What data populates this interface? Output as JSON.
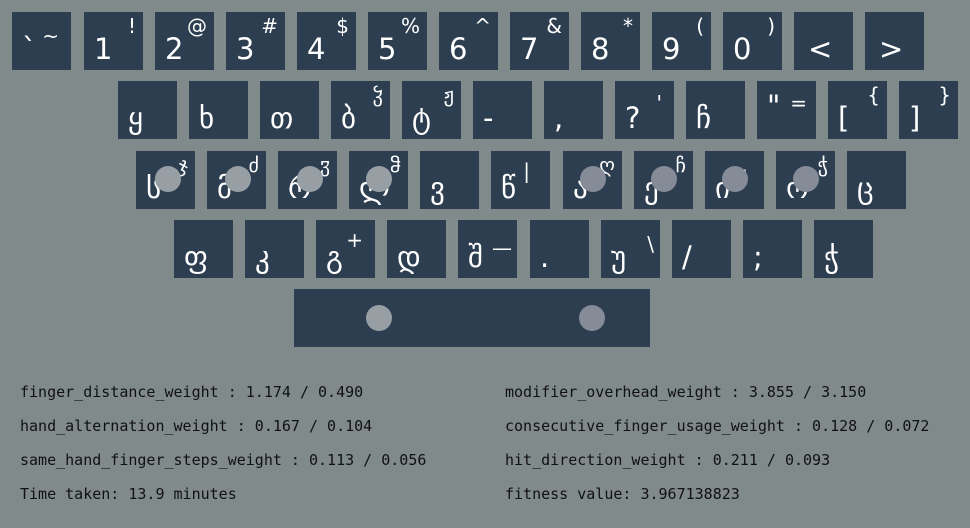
{
  "rows": [
    [
      {
        "main": "`",
        "shift": "~"
      },
      {
        "main": "1",
        "shift": "!"
      },
      {
        "main": "2",
        "shift": "@"
      },
      {
        "main": "3",
        "shift": "#"
      },
      {
        "main": "4",
        "shift": "$"
      },
      {
        "main": "5",
        "shift": "%"
      },
      {
        "main": "6",
        "shift": "^"
      },
      {
        "main": "7",
        "shift": "&"
      },
      {
        "main": "8",
        "shift": "*"
      },
      {
        "main": "9",
        "shift": "("
      },
      {
        "main": "0",
        "shift": ")"
      },
      {
        "main": "<",
        "shift": ""
      },
      {
        "main": ">",
        "shift": ""
      }
    ],
    [
      {
        "main": "ყ",
        "shift": ""
      },
      {
        "main": "ხ",
        "shift": ""
      },
      {
        "main": "თ",
        "shift": ""
      },
      {
        "main": "ბ",
        "shift": "ჴ"
      },
      {
        "main": "ტ",
        "shift": "ჟ"
      },
      {
        "main": "-",
        "shift": ""
      },
      {
        "main": ",",
        "shift": ""
      },
      {
        "main": "?",
        "shift": "'"
      },
      {
        "main": "ჩ",
        "shift": ""
      },
      {
        "main": "\"",
        "shift": "="
      },
      {
        "main": "[",
        "shift": "{"
      },
      {
        "main": "]",
        "shift": "}"
      }
    ],
    [
      {
        "main": "ს",
        "shift": "ჯ"
      },
      {
        "main": "მ",
        "shift": "ძ"
      },
      {
        "main": "რ",
        "shift": "ჳ"
      },
      {
        "main": "ლ",
        "shift": "ჵ"
      },
      {
        "main": "ვ",
        "shift": ""
      },
      {
        "main": "წ",
        "shift": "|"
      },
      {
        "main": "ა",
        "shift": "ღ"
      },
      {
        "main": "ე",
        "shift": "ჩ"
      },
      {
        "main": "ი",
        "shift": ":"
      },
      {
        "main": "ო",
        "shift": "ჭ"
      },
      {
        "main": "ც",
        "shift": ""
      }
    ],
    [
      {
        "main": "ფ",
        "shift": ""
      },
      {
        "main": "კ",
        "shift": ""
      },
      {
        "main": "გ",
        "shift": "+"
      },
      {
        "main": "დ",
        "shift": ""
      },
      {
        "main": "შ",
        "shift": "—"
      },
      {
        "main": ".",
        "shift": ""
      },
      {
        "main": "უ",
        "shift": "\\"
      },
      {
        "main": "/",
        "shift": ""
      },
      {
        "main": ";",
        "shift": ""
      },
      {
        "main": "ჭ",
        "shift": ""
      }
    ]
  ],
  "stats": {
    "finger_distance": "finger_distance_weight : 1.174 / 0.490",
    "hand_alternation": "hand_alternation_weight : 0.167 / 0.104",
    "same_hand": "same_hand_finger_steps_weight : 0.113 / 0.056",
    "time": "Time taken: 13.9 minutes",
    "modifier_overhead": "modifier_overhead_weight : 3.855 / 3.150",
    "consecutive_finger": "consecutive_finger_usage_weight : 0.128 / 0.072",
    "hit_direction": "hit_direction_weight : 0.211 / 0.093",
    "fitness": "fitness value: 3.967138823"
  }
}
